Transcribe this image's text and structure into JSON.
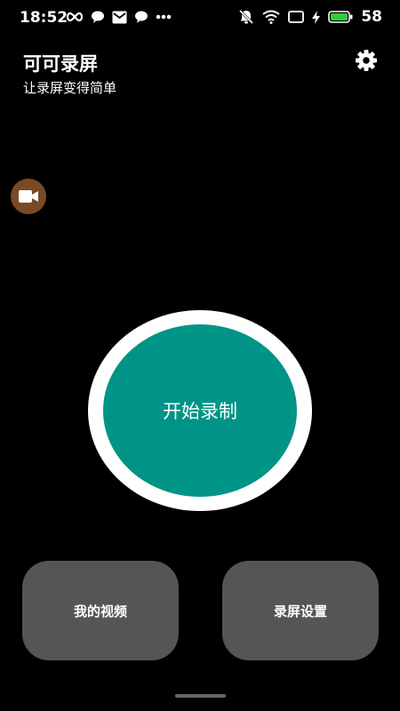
{
  "status_bar": {
    "time": "18:52",
    "battery_level": "58",
    "icons_left": [
      "infinity-icon",
      "chat-bubble-icon",
      "mail-icon",
      "chat-bubble-icon",
      "more-dots-icon"
    ],
    "icons_right": [
      "alarm-off-icon",
      "wifi-icon",
      "screen-cast-icon",
      "charging-bolt-icon",
      "battery-icon"
    ]
  },
  "header": {
    "title": "可可录屏",
    "subtitle": "让录屏变得简单",
    "settings_icon": "gear-icon"
  },
  "floating_widget": {
    "icon": "video-camera-icon",
    "color": "#7a4a26"
  },
  "record": {
    "label": "开始录制",
    "color": "#009487"
  },
  "actions": {
    "videos_label": "我的视频",
    "settings_label": "录屏设置",
    "card_color": "#555555"
  },
  "colors": {
    "background": "#000000",
    "battery_fill": "#2ecc40"
  }
}
